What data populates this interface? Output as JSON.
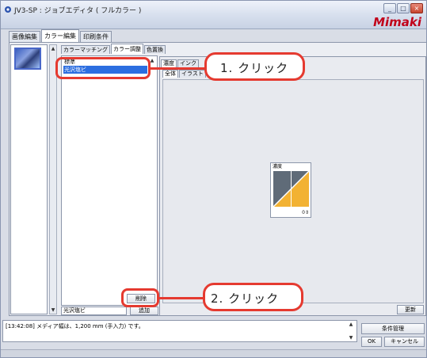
{
  "window": {
    "title": "JV3-SP : ジョブエディタ ( フルカラー )",
    "logo": "Mimaki",
    "controls": [
      "_",
      "□",
      "×"
    ]
  },
  "main_tabs": [
    "画像編集",
    "カラー編集",
    "印刷条件"
  ],
  "sub_tabs": [
    "カラーマッチング",
    "カラー調整",
    "色置換"
  ],
  "preset_list": {
    "items": [
      "標準",
      "光沢塩ビ"
    ],
    "selected_index": 1,
    "delete_label": "削除",
    "name_value": "光沢塩ビ",
    "add_label": "追加"
  },
  "adjust": {
    "tabs": [
      "濃度",
      "インク"
    ],
    "subtabs": [
      "全体",
      "イラスト"
    ],
    "density_label": "濃度",
    "density_value": "0",
    "update_label": "更新"
  },
  "status": {
    "message": "[13:42:08] メディア幅は、1,200 mm (手入力) です。"
  },
  "buttons": {
    "condition_manage": "条件管理",
    "ok": "OK",
    "cancel": "キャンセル"
  },
  "callouts": {
    "step1": "1.  クリック",
    "step2": "2.  クリック"
  },
  "colors": {
    "accent": "#e53a30",
    "selection": "#2c6ee0",
    "logo": "#c1001a",
    "curve_fill": "#f2b233"
  }
}
